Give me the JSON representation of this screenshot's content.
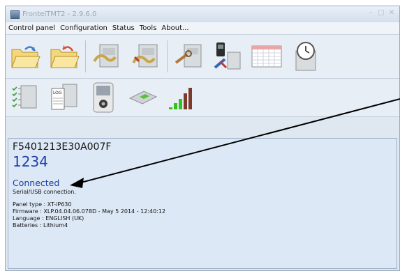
{
  "window": {
    "title": "FrontelTMT2 - 2.9.6.0",
    "controls": [
      "minimize-icon",
      "maximize-icon",
      "close-icon"
    ]
  },
  "menu": [
    "Control panel",
    "Configuration",
    "Status",
    "Tools",
    "About..."
  ],
  "toolbar_row1": [
    "open-folder-icon",
    "reload-folder-icon",
    "read-panel-icon",
    "write-panel-icon",
    "panel-tools-icon",
    "device-settings-icon",
    "calendar-icon",
    "clock-icon"
  ],
  "toolbar_row2": [
    "checklist-icon",
    "event-log-icon",
    "camera-detector-icon",
    "switch-icon",
    "signal-strength-icon"
  ],
  "device": {
    "serial": "F5401213E30A007F",
    "code": "1234",
    "status": "Connected",
    "connection_type": "Serial/USB connection.",
    "panel_type_line": "Panel type : XT-iP630",
    "firmware_line": "Firmware : XLP.04.04.06.078D - May  5 2014 - 12:40:12",
    "language_line": "Language : ENGLISH (UK)",
    "batteries_line": "Batteries : Lithium4"
  },
  "colors": {
    "status_text": "#1b3fa8",
    "window_frame": "#dfe8f1",
    "content_bg": "#dde8f6"
  }
}
